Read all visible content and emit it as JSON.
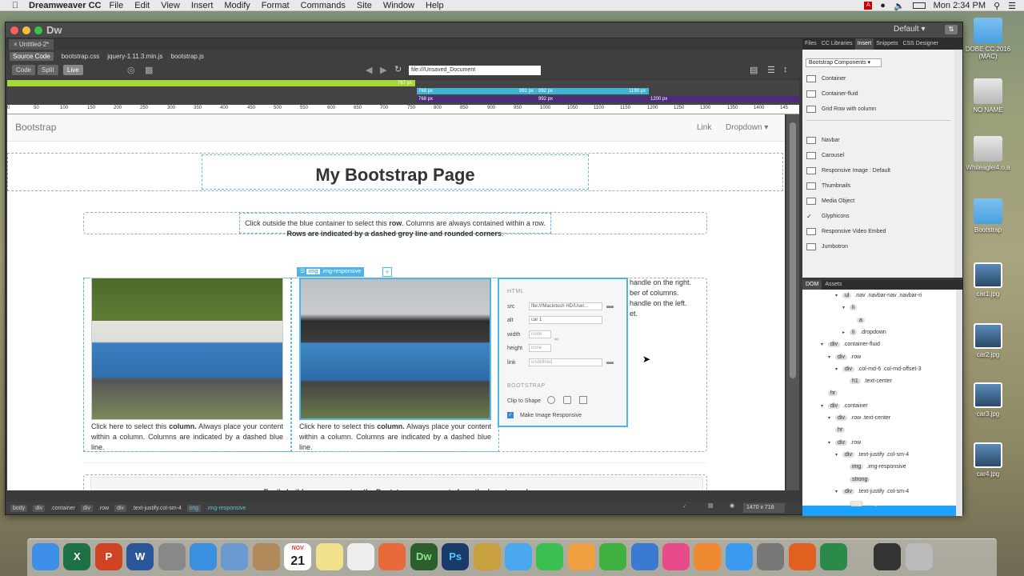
{
  "menubar": {
    "app_name": "Dreamweaver CC",
    "items": [
      "File",
      "Edit",
      "View",
      "Insert",
      "Modify",
      "Format",
      "Commands",
      "Site",
      "Window",
      "Help"
    ],
    "clock": "Mon 2:34 PM"
  },
  "desktop": {
    "icons": [
      {
        "label": "DOBE CC 2016 (MAC)",
        "kind": "folder"
      },
      {
        "label": "NO NAME",
        "kind": "drive"
      },
      {
        "label": "Whiteaglei4.o.a",
        "kind": "drive"
      },
      {
        "label": "Bootstrap",
        "kind": "folder"
      },
      {
        "label": "car1.jpg",
        "kind": "thumb"
      },
      {
        "label": "car2.jpg",
        "kind": "thumb"
      },
      {
        "label": "car3.jpg",
        "kind": "thumb"
      },
      {
        "label": "car4.jpg",
        "kind": "thumb"
      }
    ]
  },
  "window": {
    "logo": "Dw",
    "workspace": "Default",
    "doc_tab": "Untitled-2*",
    "related_files": [
      "Source Code",
      "bootstrap.css",
      "jquery-1.11.3.min.js",
      "bootstrap.js"
    ],
    "view_buttons": [
      "Code",
      "Split",
      "Live"
    ],
    "url": "file:///Unsaved_Document"
  },
  "media_queries": [
    {
      "label": "767 px",
      "color": "#a6d63a"
    },
    {
      "label": "768 px",
      "color": "#3fb3d6"
    },
    {
      "label": "991 px",
      "color": "#3fb3d6"
    },
    {
      "label": "992 px",
      "color": "#3fb3d6"
    },
    {
      "label": "1199 px",
      "color": "#3fb3d6"
    },
    {
      "label": "768 px",
      "color": "#4a2c7a"
    },
    {
      "label": "992 px",
      "color": "#4a2c7a"
    },
    {
      "label": "1200 px",
      "color": "#4a2c7a"
    }
  ],
  "ruler_ticks": [
    "0",
    "50",
    "100",
    "150",
    "200",
    "250",
    "300",
    "350",
    "400",
    "450",
    "500",
    "550",
    "600",
    "650",
    "700",
    "750",
    "800",
    "850",
    "900",
    "950",
    "1000",
    "1050",
    "1100",
    "1150",
    "1200",
    "1250",
    "1300",
    "1350",
    "1400",
    "145"
  ],
  "page": {
    "brand": "Bootstrap",
    "nav_link": "Link",
    "nav_dropdown": "Dropdown ▾",
    "heading": "My Bootstrap Page",
    "row_text_1": "Click outside the blue container to select this ",
    "row_text_bold1": "row",
    "row_text_2": ". Columns are always contained within a row. ",
    "row_text_bold2": "Rows are indicated by a dashed grey line and rounded corners",
    "row_text_3": ".",
    "col_text_a": "Click here to select this ",
    "col_text_bold": "column.",
    "col_text_b": " Always place your content within a column. Columns are indicated by a dashed blue line.",
    "right_frag_1": "handle on the right.",
    "right_frag_2": "ber of columns.",
    "right_frag_3": "handle on the left.",
    "right_frag_4": "et.",
    "img_tag": "img",
    "img_class": ".img-responsive",
    "bottom_text": "Easily build your page using the Bootstrap components from the Insert panel."
  },
  "property_panel": {
    "html_heading": "HTML",
    "src_label": "src",
    "src_value": "file:///Macintosh HD/User...",
    "alt_label": "alt",
    "alt_value": "car 1",
    "width_label": "width",
    "width_placeholder": "none",
    "height_label": "height",
    "height_placeholder": "none",
    "link_label": "link",
    "link_placeholder": "undefined",
    "bootstrap_heading": "BOOTSTRAP",
    "clip_label": "Clip to Shape",
    "responsive_label": "Make Image Responsive"
  },
  "tag_selector": [
    "body",
    "div",
    ".container",
    "div",
    ".row",
    "div",
    ".text-justify.col-sm-4",
    "img",
    ".img-responsive"
  ],
  "doc_size": "1470 x 718",
  "panels": {
    "tabs": [
      "Files",
      "CC Libraries",
      "Insert",
      "Snippets",
      "CSS Designer"
    ],
    "category": "Bootstrap Components",
    "insert_items": [
      "Container",
      "Container-fluid",
      "Grid Row with column",
      "Navbar",
      "Carousel",
      "Responsive Image : Default",
      "Thumbnails",
      "Media Object",
      "Glyphicons",
      "Responsive Video Embed",
      "Jumbotron"
    ],
    "dom_tabs": [
      "DOM",
      "Assets"
    ]
  },
  "dom_tree": [
    {
      "tag": "ul",
      "cls": ".nav .navbar-nav .navbar-ri",
      "indent": 5
    },
    {
      "tag": "li",
      "cls": "",
      "indent": 6
    },
    {
      "tag": "a",
      "cls": "",
      "indent": 7
    },
    {
      "tag": "li",
      "cls": ".dropdown",
      "indent": 6
    },
    {
      "tag": "div",
      "cls": ".container-fluid",
      "indent": 3
    },
    {
      "tag": "div",
      "cls": ".row",
      "indent": 4
    },
    {
      "tag": "div",
      "cls": ".col-md-6 .col-md-offset-3",
      "indent": 5
    },
    {
      "tag": "h1",
      "cls": ".text-center",
      "indent": 6
    },
    {
      "tag": "hr",
      "cls": "",
      "indent": 3
    },
    {
      "tag": "div",
      "cls": ".container",
      "indent": 3
    },
    {
      "tag": "div",
      "cls": ".row .text-center",
      "indent": 4
    },
    {
      "tag": "hr",
      "cls": "",
      "indent": 4
    },
    {
      "tag": "div",
      "cls": ".row",
      "indent": 4
    },
    {
      "tag": "div",
      "cls": ".text-justify .col-sm-4",
      "indent": 5
    },
    {
      "tag": "img",
      "cls": ".img-responsive",
      "indent": 6
    },
    {
      "tag": "strong",
      "cls": "",
      "indent": 6
    },
    {
      "tag": "div",
      "cls": ".text-justify .col-sm-4",
      "indent": 5
    },
    {
      "tag": "img",
      "cls": ".img-responsive",
      "indent": 6
    }
  ],
  "dock_apps": [
    "Finder",
    "Excel",
    "PowerPoint",
    "Word",
    "Launchpad",
    "Safari",
    "Preview",
    "Contacts",
    "Calendar",
    "Notes",
    "Reminders",
    "Photos",
    "Dreamweaver",
    "Photoshop",
    "Font",
    "Messages",
    "FaceTime",
    "Pages",
    "Numbers",
    "Keynote",
    "iTunes",
    "iBooks",
    "App Store",
    "System Preferences",
    "Firefox",
    "Xcode",
    "Terminal",
    "Trash"
  ],
  "calendar_day": "21",
  "calendar_month": "NOV"
}
